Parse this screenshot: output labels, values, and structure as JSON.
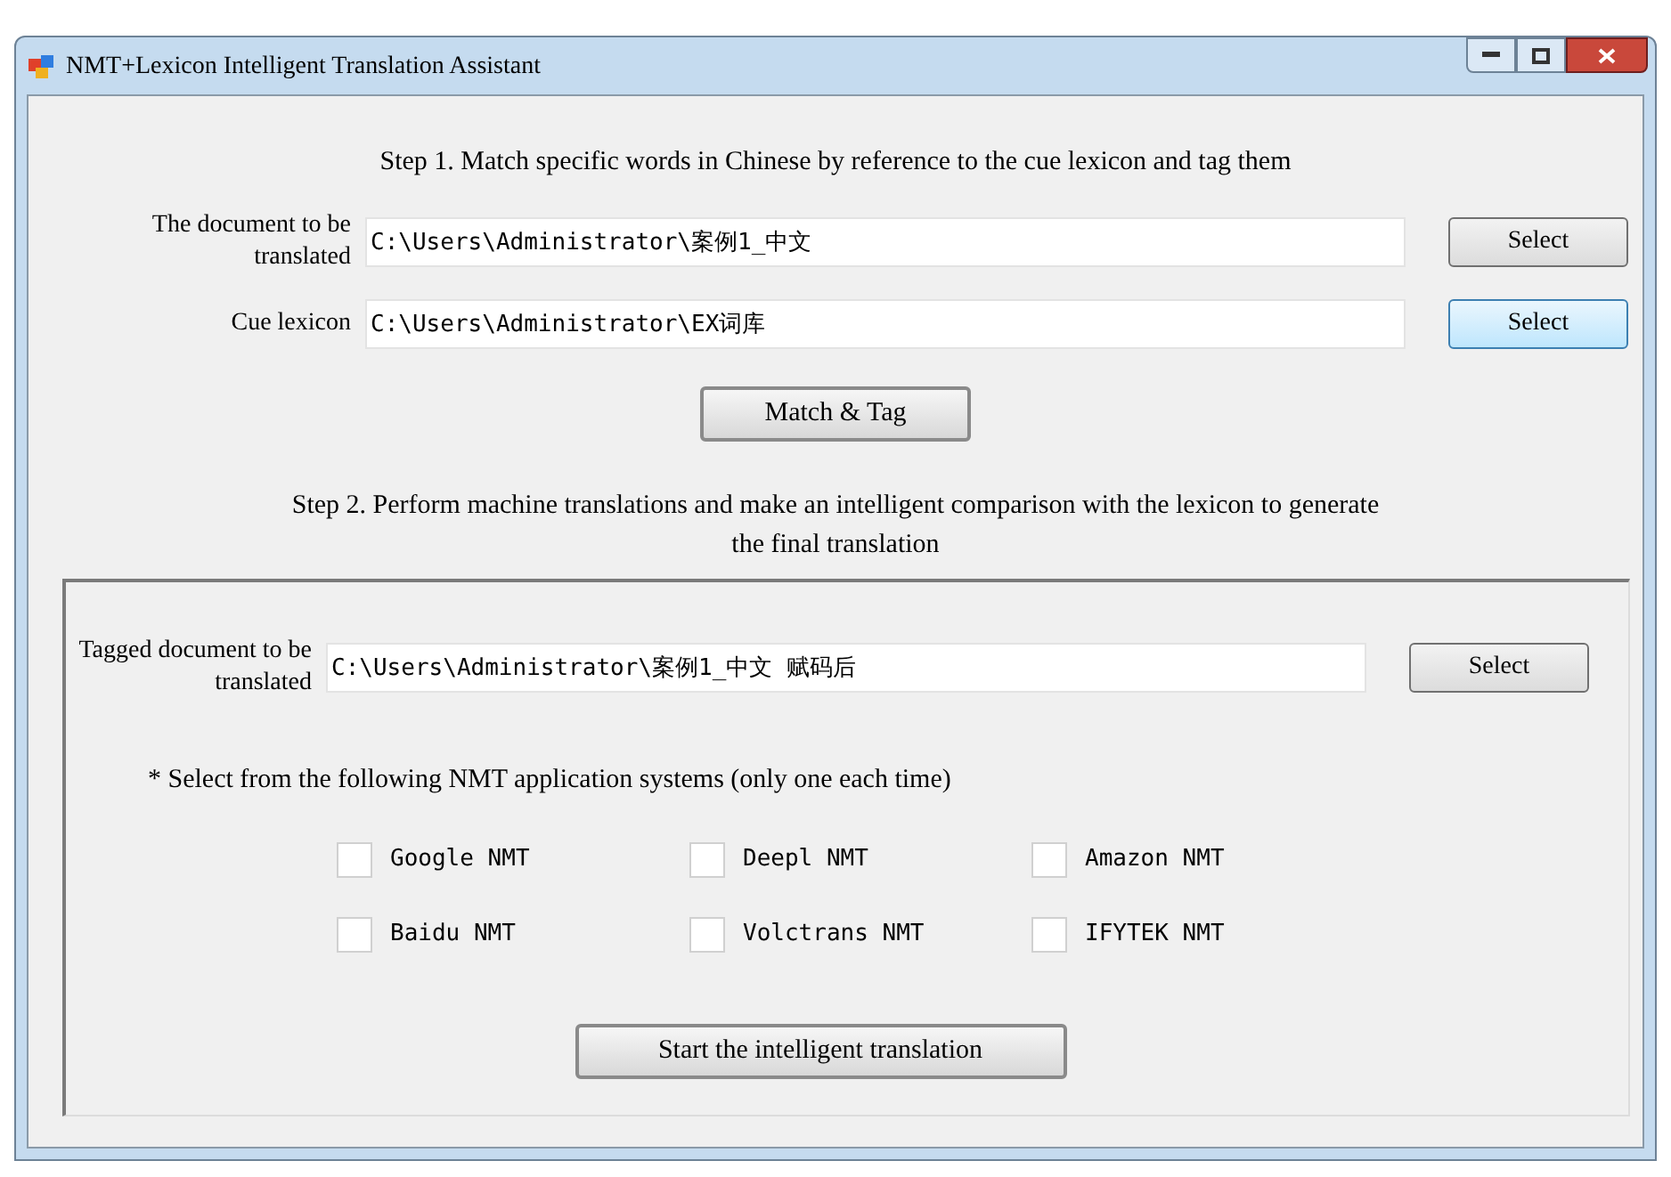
{
  "window": {
    "title": "NMT+Lexicon Intelligent Translation Assistant"
  },
  "step1": {
    "heading": "Step 1. Match specific words in Chinese by reference to the cue lexicon and tag them",
    "rows": [
      {
        "label": "The document to be translated",
        "value": "C:\\Users\\Administrator\\案例1_中文",
        "button": "Select",
        "focused": false
      },
      {
        "label": "Cue lexicon",
        "value": "C:\\Users\\Administrator\\EX词库",
        "button": "Select",
        "focused": true
      }
    ],
    "action": "Match & Tag"
  },
  "step2": {
    "heading": "Step 2. Perform machine translations and make an intelligent comparison with the lexicon to generate the final translation",
    "row": {
      "label": "Tagged document to be translated",
      "value": "C:\\Users\\Administrator\\案例1_中文 赋码后",
      "button": "Select"
    },
    "note": "* Select from the following NMT application systems (only one each time)",
    "options": [
      {
        "label": "Google NMT",
        "checked": false
      },
      {
        "label": "Deepl NMT",
        "checked": false
      },
      {
        "label": "Amazon NMT",
        "checked": false
      },
      {
        "label": "Baidu NMT",
        "checked": false
      },
      {
        "label": "Volctrans NMT",
        "checked": false
      },
      {
        "label": "IFYTEK NMT",
        "checked": false
      }
    ],
    "action": "Start the intelligent translation"
  }
}
